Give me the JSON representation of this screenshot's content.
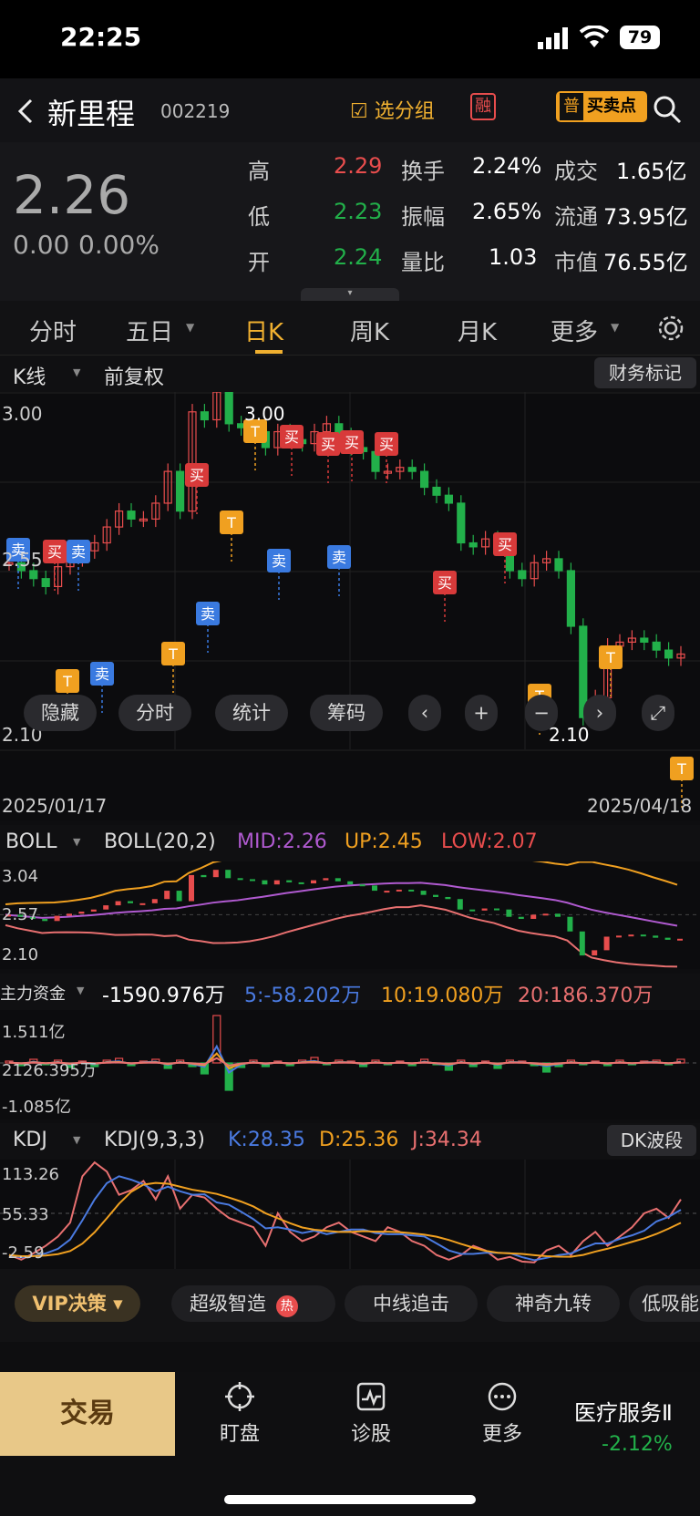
{
  "status": {
    "time": "22:25",
    "battery": "79"
  },
  "header": {
    "stock_name": "新里程",
    "stock_code": "002219",
    "group_label": "选分组",
    "rong_badge": "融",
    "buysell_badge": "普",
    "buysell_label": "买卖点"
  },
  "quote": {
    "price": "2.26",
    "change": "0.00",
    "change_pct": "0.00%",
    "high_label": "高",
    "high": "2.29",
    "low_label": "低",
    "low": "2.23",
    "open_label": "开",
    "open": "2.24",
    "turnover_label": "换手",
    "turnover": "2.24%",
    "amplitude_label": "振幅",
    "amplitude": "2.65%",
    "volratio_label": "量比",
    "volratio": "1.03",
    "amount_label": "成交",
    "amount": "1.65亿",
    "float_label": "流通",
    "float": "73.95亿",
    "mktcap_label": "市值",
    "mktcap": "76.55亿"
  },
  "tabs": [
    "分时",
    "五日",
    "日K",
    "周K",
    "月K",
    "更多"
  ],
  "subbar": {
    "kline": "K线",
    "adjust": "前复权",
    "finance_mark": "财务标记"
  },
  "kchart": {
    "y_top": "3.00",
    "y_mid": "2.55",
    "y_bottom": "2.10",
    "max_label": "3.00",
    "min_label": "2.10",
    "date_start": "2025/01/17",
    "date_end": "2025/04/18",
    "controls": [
      "隐藏",
      "分时",
      "统计",
      "筹码"
    ],
    "buy": "买",
    "sell": "卖",
    "t": "T"
  },
  "boll": {
    "name": "BOLL",
    "params": "BOLL(20,2)",
    "mid": "MID:2.26",
    "up": "UP:2.45",
    "low": "LOW:2.07",
    "y_top": "3.04",
    "y_mid": "2.57",
    "y_bottom": "2.10"
  },
  "capital": {
    "name": "主力资金",
    "value": "-1590.976万",
    "ma5": "5:-58.202万",
    "ma10": "10:19.080万",
    "ma20": "20:186.370万",
    "y_top": "1.511亿",
    "y_mid": "2126.395万",
    "y_bottom": "-1.085亿"
  },
  "kdj": {
    "name": "KDJ",
    "params": "KDJ(9,3,3)",
    "k": "K:28.35",
    "d": "D:25.36",
    "j": "J:34.34",
    "dk_label": "DK波段",
    "y_top": "113.26",
    "y_mid": "55.33",
    "y_bottom": "-2.59"
  },
  "vip": {
    "label": "VIP决策",
    "items": [
      "超级智造",
      "中线追击",
      "神奇九转",
      "低吸能"
    ],
    "hot": "热"
  },
  "bottom": {
    "trade": "交易",
    "nav": [
      "盯盘",
      "诊股",
      "更多"
    ],
    "sector_name": "医疗服务Ⅱ",
    "sector_change": "-2.12%"
  },
  "colors": {
    "up": "#e84d4d",
    "down": "#22b04a",
    "accent": "#f0a020",
    "purple": "#b05ad0",
    "blue": "#4a7ae0"
  }
}
